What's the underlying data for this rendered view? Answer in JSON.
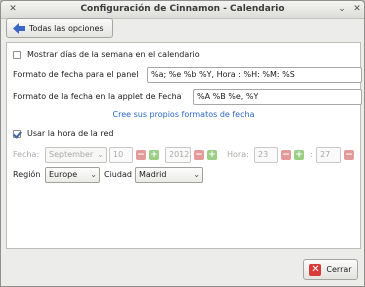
{
  "window": {
    "title": "Configuración de Cinnamon - Calendario",
    "minimize_glyph": "⌄",
    "close_glyph": "✕"
  },
  "toolbar": {
    "back_label": "Todas las opciones",
    "back_icon": "left-arrow-icon"
  },
  "settings": {
    "show_weekdays_label": "Mostrar días de la semana en el calendario",
    "show_weekdays_checked": false,
    "panel_format_label": "Formato de fecha para el panel",
    "panel_format_value": "%a; %e %b %Y, Hora : %H: %M: %S",
    "applet_format_label": "Formato de la fecha en la applet de Fecha",
    "applet_format_value": "%A %B %e, %Y",
    "custom_link": "Cree sus propios formatos de fecha",
    "network_time_label": "Usar la hora de la red",
    "network_time_checked": true
  },
  "datetime": {
    "date_label": "Fecha:",
    "month": "September",
    "day": "10",
    "year": "2012",
    "time_label": "Hora:",
    "hour": "23",
    "separator": ":",
    "minute": "27",
    "minus_glyph": "−",
    "plus_glyph": "+"
  },
  "location": {
    "region_label": "Región",
    "region_value": "Europe",
    "city_label": "Ciudad",
    "city_value": "Madrid",
    "dropdown_glyph": "⌄"
  },
  "footer": {
    "close_label": "Cerrar",
    "close_icon_glyph": "✕"
  },
  "colors": {
    "link": "#2a67c2",
    "arrow": "#3a66c4",
    "close_icon": "#d83a3a",
    "minus": "#e39a9a",
    "plus": "#9ccf86"
  }
}
